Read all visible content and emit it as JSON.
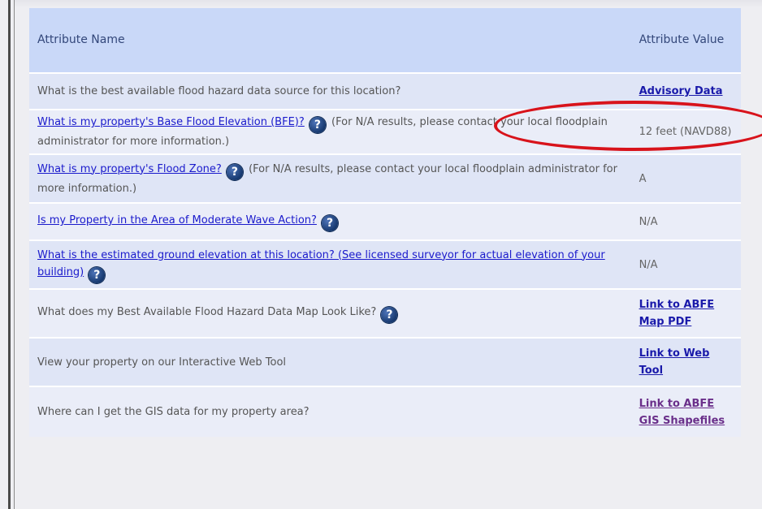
{
  "table": {
    "header": {
      "name": "Attribute Name",
      "value": "Attribute Value"
    },
    "rows": [
      {
        "question": "What is the best available flood hazard data source for this location?",
        "value": "Advisory Data"
      },
      {
        "question": "What is my property's Base Flood Elevation (BFE)?",
        "note": "(For N/A results, please contact your local floodplain administrator for more information.)",
        "value": "12 feet (NAVD88)"
      },
      {
        "question": "What is my property's Flood Zone?",
        "note": "(For N/A results, please contact your local floodplain administrator for more information.)",
        "value": "A"
      },
      {
        "question": "Is my Property in the Area of Moderate Wave Action?",
        "value": "N/A"
      },
      {
        "question": "What is the estimated ground elevation at this location? (See licensed surveyor for actual elevation of your building)",
        "value": "N/A"
      },
      {
        "question": "What does my Best Available Flood Hazard Data Map Look Like?",
        "value": "Link to ABFE Map PDF"
      },
      {
        "question": "View your property on our Interactive Web Tool",
        "value": "Link to Web Tool"
      },
      {
        "question": "Where can I get the GIS data for my property area?",
        "value": "Link to ABFE GIS Shapefiles"
      }
    ]
  },
  "help_icon_glyph": "?",
  "annotation_color": "#d8131b"
}
